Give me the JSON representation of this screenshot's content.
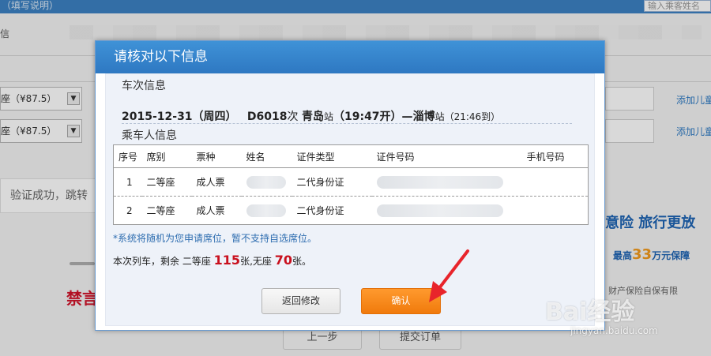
{
  "background": {
    "topbar_text": "（填写说明）",
    "search_placeholder": "输入乘客姓名",
    "left_label": "信",
    "seat_select_1": "座（¥87.5）",
    "seat_select_2": "座（¥87.5）",
    "add_child_1": "添加儿童",
    "add_child_2": "添加儿童",
    "verify_text": "验证成功，跳转",
    "promo_text": "禁言",
    "banner_line1": "意险  旅行更放",
    "banner_line2_prefix": "最高",
    "banner_line2_num": "33",
    "banner_line2_suffix": "万元保障",
    "banner_line3": "财产保险自保有限",
    "prev_button": "上一步",
    "submit_button": "提交订单"
  },
  "dialog": {
    "title": "请核对以下信息",
    "train_section_title": "车次信息",
    "train": {
      "date": "2015-12-31（周四）",
      "number": "D6018",
      "number_suffix": "次",
      "from": "青岛",
      "from_suffix": "站",
      "depart": "（19:47开）—",
      "to": "淄博",
      "to_suffix": "站",
      "arrive": "（21:46到）"
    },
    "passenger_section_title": "乘车人信息",
    "table": {
      "headers": [
        "序号",
        "席别",
        "票种",
        "姓名",
        "证件类型",
        "证件号码",
        "手机号码"
      ],
      "rows": [
        {
          "no": "1",
          "seat": "二等座",
          "ticket": "成人票",
          "id_type": "二代身份证"
        },
        {
          "no": "2",
          "seat": "二等座",
          "ticket": "成人票",
          "id_type": "二代身份证"
        }
      ]
    },
    "note_blue": "*系统将随机为您申请席位，暂不支持自选席位。",
    "remain": {
      "prefix": "本次列车，剩余 二等座",
      "count1": "115",
      "mid": "张,无座",
      "count2": "70",
      "suffix": "张。"
    },
    "back_button": "返回修改",
    "confirm_button": "确认"
  },
  "watermark": {
    "brand": "Bai经验",
    "url": "jingyan.baidu.com"
  },
  "colors": {
    "header_blue": "#3587cc",
    "confirm_orange": "#f68a1f",
    "remain_red": "#c9101e",
    "arrow_red": "#e8242b"
  }
}
